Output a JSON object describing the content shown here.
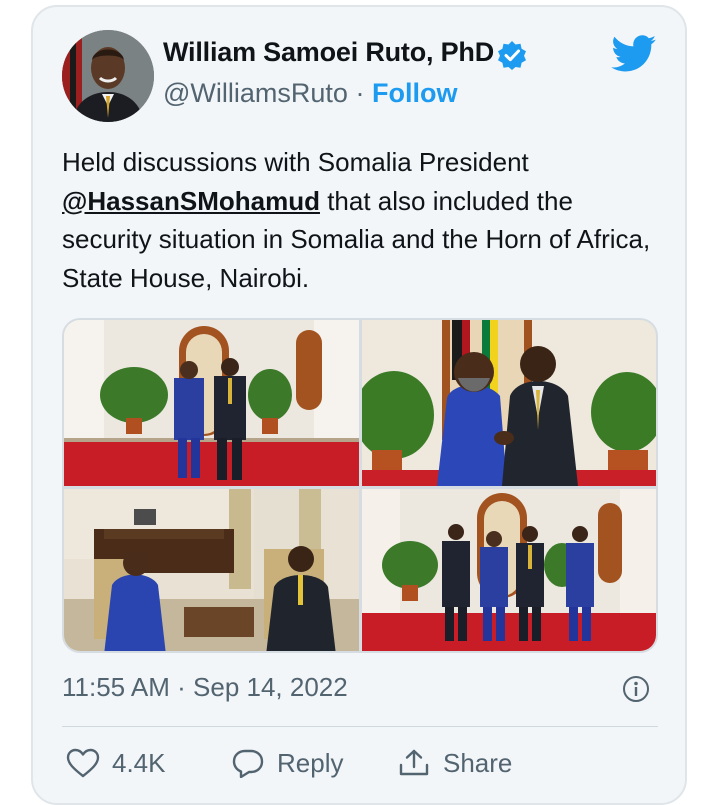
{
  "author": {
    "name": "William Samoei Ruto, PhD",
    "handle": "@WilliamsRuto",
    "separator": "·",
    "follow_label": "Follow",
    "verified": true
  },
  "tweet": {
    "text_before": "Held discussions with Somalia President ",
    "mention": "@HassanSMohamud",
    "text_after": " that also included the security situation in Somalia and the  Horn of Africa, State House, Nairobi.",
    "photo_count": 4
  },
  "meta": {
    "timestamp": "11:55 AM · Sep 14, 2022"
  },
  "actions": {
    "like_count": "4.4K",
    "reply_label": "Reply",
    "share_label": "Share"
  },
  "icons": {
    "verified": "verified-badge-icon",
    "bird": "twitter-bird-icon",
    "info": "info-icon",
    "like": "heart-icon",
    "reply": "reply-bubble-icon",
    "share": "share-icon"
  },
  "colors": {
    "accent": "#1d9bf0",
    "card_bg": "#f3f6f8",
    "muted_text": "#536471"
  }
}
